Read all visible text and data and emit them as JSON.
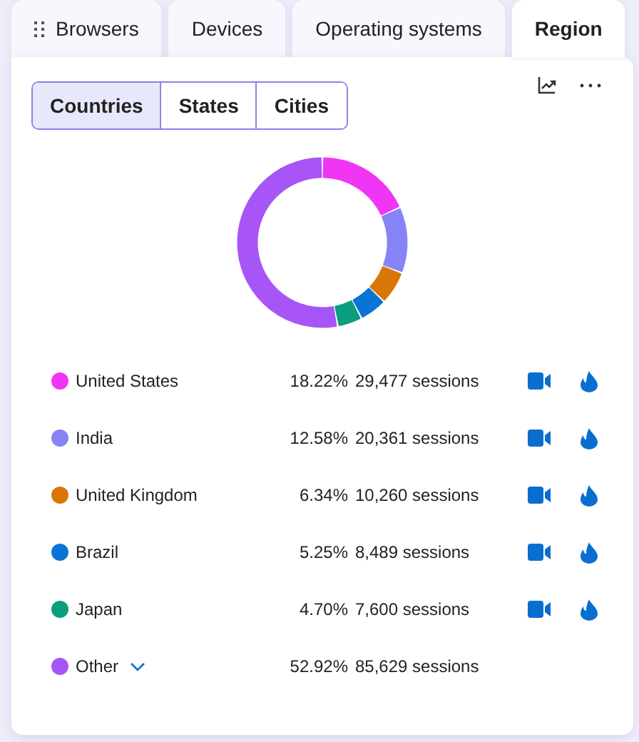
{
  "tabs": [
    {
      "label": "Browsers",
      "selected": false
    },
    {
      "label": "Devices",
      "selected": false
    },
    {
      "label": "Operating systems",
      "selected": false
    },
    {
      "label": "Region",
      "selected": true
    }
  ],
  "segments": [
    {
      "label": "Countries",
      "selected": true
    },
    {
      "label": "States",
      "selected": false
    },
    {
      "label": "Cities",
      "selected": false
    }
  ],
  "chart_data": {
    "type": "donut",
    "categories": [
      "United States",
      "India",
      "United Kingdom",
      "Brazil",
      "Japan",
      "Other"
    ],
    "values": [
      18.22,
      12.58,
      6.34,
      5.25,
      4.7,
      52.92
    ]
  },
  "rows": [
    {
      "kind": "country",
      "color": "#f135f5",
      "percent": "18.22%",
      "sessions": "29,477 sessions"
    },
    {
      "kind": "country",
      "color": "#8683f7",
      "percent": "12.58%",
      "sessions": "20,361 sessions"
    },
    {
      "kind": "country",
      "color": "#d97706",
      "percent": "6.34%",
      "sessions": "10,260 sessions"
    },
    {
      "kind": "country",
      "color": "#0a74d6",
      "percent": "5.25%",
      "sessions": "8,489 sessions"
    },
    {
      "kind": "country",
      "color": "#0a9e7e",
      "percent": "4.70%",
      "sessions": "7,600 sessions"
    },
    {
      "kind": "other",
      "color": "#a855f7",
      "percent": "52.92%",
      "sessions": "85,629 sessions"
    }
  ]
}
